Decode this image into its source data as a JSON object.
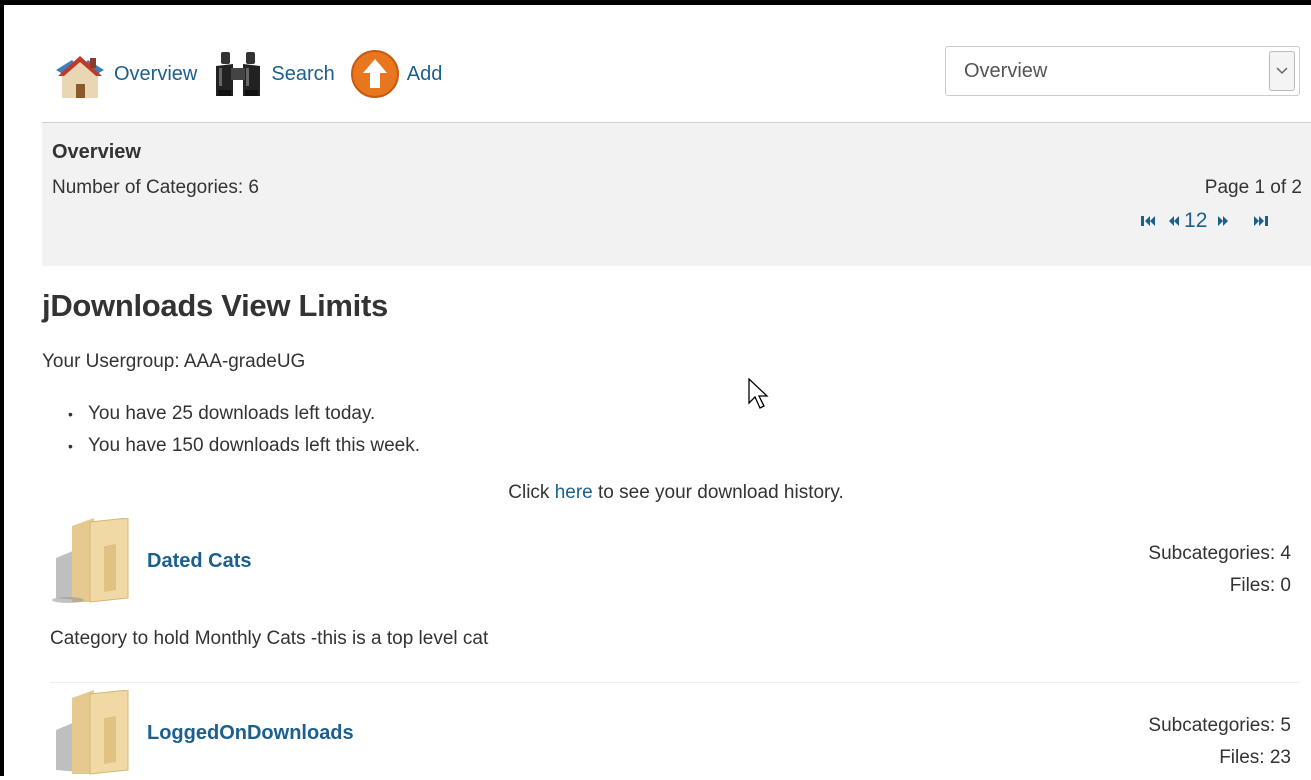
{
  "toolbar": {
    "overview_label": "Overview",
    "search_label": "Search",
    "add_label": "Add"
  },
  "view_select": {
    "value": "Overview"
  },
  "overview_panel": {
    "title": "Overview",
    "count_text": "Number of Categories: 6",
    "page_text": "Page 1 of 2",
    "pages": [
      "1",
      "2"
    ]
  },
  "limits": {
    "heading": "jDownloads View Limits",
    "usergroup_text": "Your Usergroup: AAA-gradeUG",
    "items": [
      "You have 25 downloads left today.",
      "You have 150 downloads left this week."
    ],
    "history_prefix": "Click ",
    "history_link": "here",
    "history_suffix": " to see your download history."
  },
  "categories": [
    {
      "name": "Dated Cats",
      "subcategories": "Subcategories: 4",
      "files": "Files: 0",
      "description": "Category to hold Monthly Cats -this is a top level cat"
    },
    {
      "name": "LoggedOnDownloads",
      "subcategories": "Subcategories: 5",
      "files": "Files: 23"
    }
  ],
  "colors": {
    "link": "#1b5f8f",
    "panel_bg": "#f2f2f2",
    "add_orange": "#e8761e"
  }
}
